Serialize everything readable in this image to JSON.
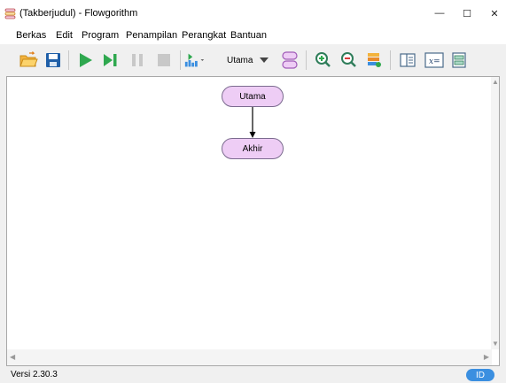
{
  "window": {
    "title": "(Takberjudul) - Flowgorithm",
    "minimize_glyph": "—",
    "maximize_glyph": "☐",
    "close_glyph": "✕"
  },
  "menu": {
    "items": [
      "Berkas",
      "Edit",
      "Program",
      "Penampilan",
      "Perangkat",
      "Bantuan"
    ]
  },
  "toolbar": {
    "function_selector": "Utama",
    "icons": [
      "open-folder-icon",
      "save-icon",
      "run-icon",
      "step-icon",
      "pause-icon",
      "stop-icon",
      "layout-icon",
      "add-function-icon",
      "zoom-in-icon",
      "zoom-out-icon",
      "variables-icon",
      "panel-layout-icon",
      "variable-watch-icon",
      "console-icon"
    ]
  },
  "flowchart": {
    "nodes": [
      {
        "label": "Utama",
        "kind": "start"
      },
      {
        "label": "Akhir",
        "kind": "end"
      }
    ]
  },
  "status": {
    "version": "Versi 2.30.3",
    "language": "ID"
  },
  "colors": {
    "node_fill": "#eecdf5",
    "node_border": "#7b6b8f",
    "run_green": "#2fa84f",
    "accent_blue": "#3b8fe0"
  }
}
